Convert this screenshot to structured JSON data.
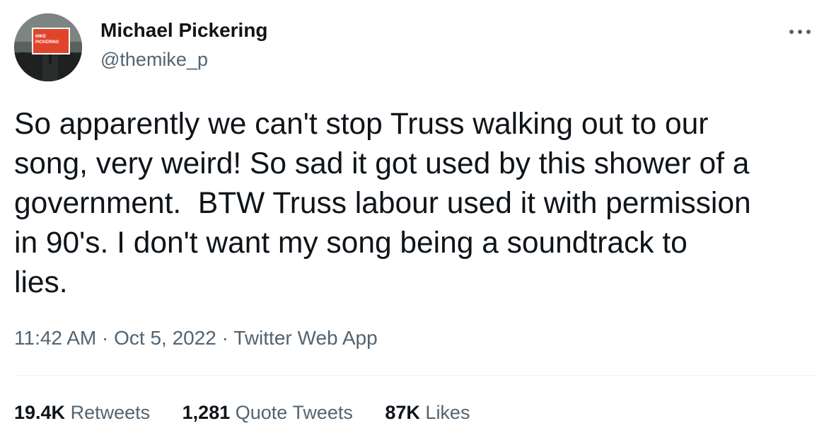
{
  "author": {
    "name": "Michael Pickering",
    "handle": "@themike_p",
    "avatar_sign_text": "MIKE PICKERING"
  },
  "more_icon": "more-horizontal-icon",
  "tweet": {
    "text": "So apparently we can't stop Truss walking out to our\nsong, very weird! So sad it got used by this shower of a\ngovernment.  BTW Truss labour used it with permission\nin 90's. I don't want my song being a soundtrack to\nlies."
  },
  "meta": {
    "time": "11:42 AM",
    "separator": "·",
    "date": "Oct 5, 2022",
    "source": "Twitter Web App"
  },
  "stats": {
    "retweets_count": "19.4K",
    "retweets_label": "Retweets",
    "quotes_count": "1,281",
    "quotes_label": "Quote Tweets",
    "likes_count": "87K",
    "likes_label": "Likes"
  },
  "colors": {
    "text_primary": "#0f1419",
    "text_secondary": "#536471",
    "divider": "#eff3f4",
    "sign_red": "#e0452c"
  }
}
